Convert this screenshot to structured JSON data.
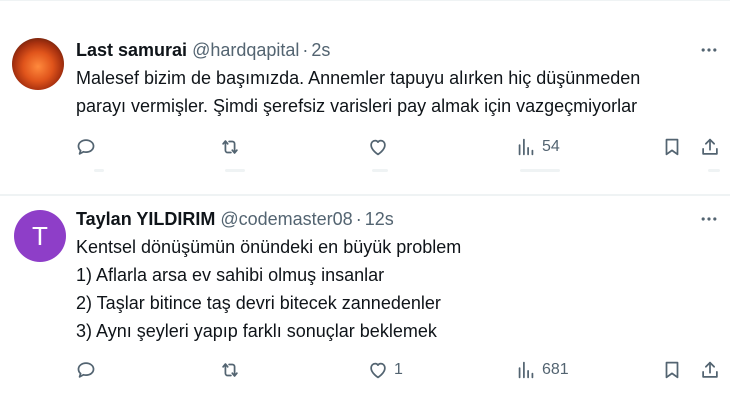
{
  "tweets": [
    {
      "display_name": "Last samurai",
      "handle": "@hardqapital",
      "separator": "·",
      "time": "2s",
      "avatar": {
        "kind": "photo"
      },
      "text_lines": [
        "Malesef bizim de başımızda. Annemler tapuyu alırken hiç düşünmeden",
        "parayı vermişler. Şimdi şerefsiz varisleri pay almak için vazgeçmiyorlar"
      ],
      "stats": {
        "replies": "",
        "retweets": "",
        "likes": "",
        "views": "54"
      },
      "icons": [
        "reply-icon",
        "retweet-icon",
        "heart-icon",
        "views-icon",
        "bookmark-icon",
        "share-icon",
        "more-icon"
      ]
    },
    {
      "display_name": "Taylan YILDIRIM",
      "handle": "@codemaster08",
      "separator": "·",
      "time": "12s",
      "avatar": {
        "kind": "letter",
        "letter": "T",
        "color": "#8e3ec8"
      },
      "text_lines": [
        "Kentsel dönüşümün önündeki en büyük problem",
        "1) Aflarla arsa ev sahibi olmuş insanlar",
        "2) Taşlar bitince taş devri bitecek zannedenler",
        "3) Aynı şeyleri yapıp farklı sonuçlar beklemek"
      ],
      "stats": {
        "replies": "",
        "retweets": "",
        "likes": "1",
        "views": "681"
      },
      "icons": [
        "reply-icon",
        "retweet-icon",
        "heart-icon",
        "views-icon",
        "bookmark-icon",
        "share-icon",
        "more-icon"
      ]
    }
  ],
  "colors": {
    "text": "#0f1419",
    "secondary": "#536471",
    "divider": "#eff3f4",
    "background": "#ffffff"
  }
}
